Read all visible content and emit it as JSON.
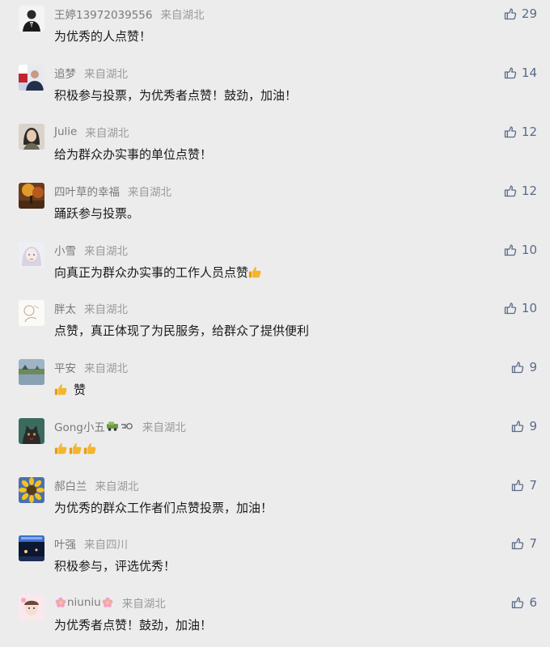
{
  "comments": [
    {
      "name": "王婷13972039556",
      "location": "来自湖北",
      "text": "为优秀的人点赞！",
      "likes": "29",
      "avatar": "avatar-suit-man-icon"
    },
    {
      "name": "追梦",
      "location": "来自湖北",
      "text": "积极参与投票，为优秀者点赞！鼓劲，加油！",
      "likes": "14",
      "avatar": "avatar-flag-portrait-icon"
    },
    {
      "name": "Julie",
      "location": "来自湖北",
      "text": "给为群众办实事的单位点赞！",
      "likes": "12",
      "avatar": "avatar-girl-portrait-icon"
    },
    {
      "name": "四叶草的幸福",
      "location": "来自湖北",
      "text": "踊跃参与投票。",
      "likes": "12",
      "avatar": "avatar-autumn-scene-icon"
    },
    {
      "name": "小雪",
      "location": "来自湖北",
      "text": "向真正为群众办实事的工作人员点赞",
      "likes": "10",
      "avatar": "avatar-doll-icon",
      "emoji_after": 1
    },
    {
      "name": "胖太",
      "location": "来自湖北",
      "text": "点赞，真正体现了为民服务，给群众了提供便利",
      "likes": "10",
      "avatar": "avatar-sketch-icon"
    },
    {
      "name": "平安",
      "location": "来自湖北",
      "text": "赞",
      "likes": "9",
      "avatar": "avatar-lake-landscape-icon",
      "emoji_before": 1
    },
    {
      "name": "Gong小五",
      "location": "来自湖北",
      "text": "",
      "likes": "9",
      "avatar": "avatar-cat-icon",
      "emoji_before": 3,
      "name_emojis": [
        "car-emoji-icon",
        "dash-emoji-icon"
      ]
    },
    {
      "name": "郝白兰",
      "location": "来自湖北",
      "text": "为优秀的群众工作者们点赞投票，加油！",
      "likes": "7",
      "avatar": "avatar-sunflower-icon"
    },
    {
      "name": "叶强",
      "location": "来自四川",
      "text": "积极参与，评选优秀！",
      "likes": "7",
      "avatar": "avatar-night-scene-icon"
    },
    {
      "name": "niuniu",
      "location": "来自湖北",
      "text": "为优秀者点赞！鼓劲，加油！",
      "likes": "6",
      "avatar": "avatar-baby-photo-icon",
      "name_flower": true
    }
  ],
  "colors": {
    "background": "#ececec",
    "meta_text": "#7a7a7a",
    "comment_text": "#1a1a1a",
    "like_color": "#5a6a8a",
    "thumbs_emoji": "#f3b62d"
  }
}
